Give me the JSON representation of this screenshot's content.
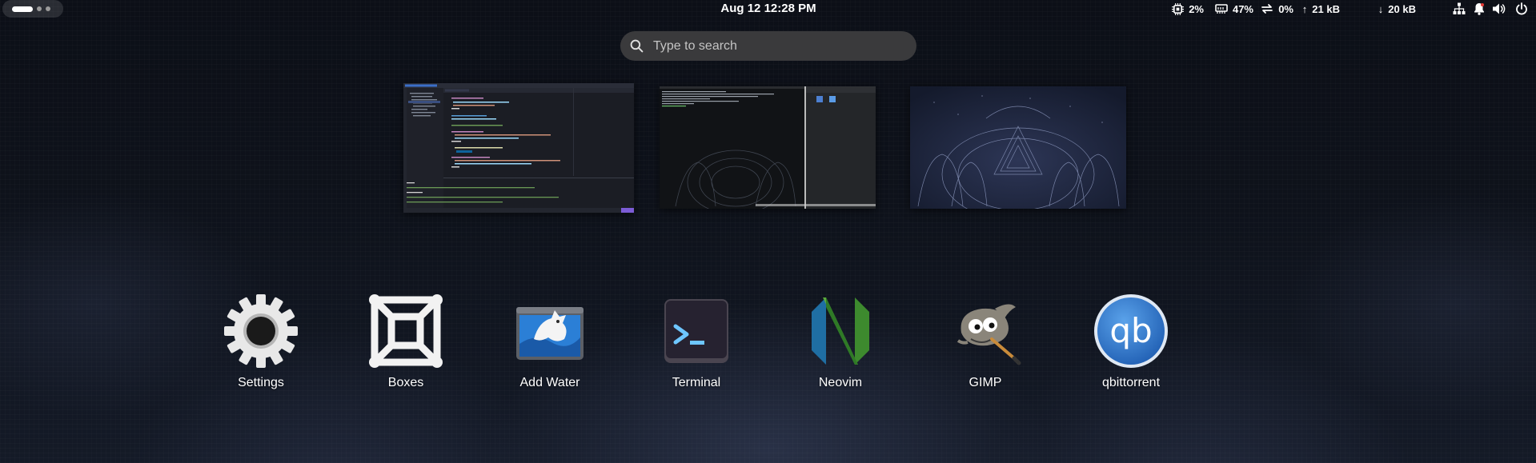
{
  "topbar": {
    "clock": "Aug 12  12:28 PM",
    "cpu": "2%",
    "memory": "47%",
    "swap": "0%",
    "upload": "21 kB",
    "download": "20 kB"
  },
  "search": {
    "placeholder": "Type to search"
  },
  "windows": [
    {
      "name": "code-editor"
    },
    {
      "name": "terminal-with-file-manager"
    },
    {
      "name": "wallpaper-image-viewer"
    }
  ],
  "dash": {
    "apps": [
      {
        "label": "Settings",
        "icon": "gear-icon"
      },
      {
        "label": "Boxes",
        "icon": "boxes-icon"
      },
      {
        "label": "Add Water",
        "icon": "add-water-icon"
      },
      {
        "label": "Terminal",
        "icon": "terminal-icon"
      },
      {
        "label": "Neovim",
        "icon": "neovim-icon"
      },
      {
        "label": "GIMP",
        "icon": "gimp-icon"
      },
      {
        "label": "qbittorrent",
        "icon": "qbittorrent-icon"
      }
    ]
  },
  "colors": {
    "background": "#0e121b",
    "search_bg": "#3a3a3c",
    "qbittorrent_blue": "#2f74c8",
    "neovim_green": "#3d8a2e",
    "neovim_blue": "#1f6ea3"
  }
}
